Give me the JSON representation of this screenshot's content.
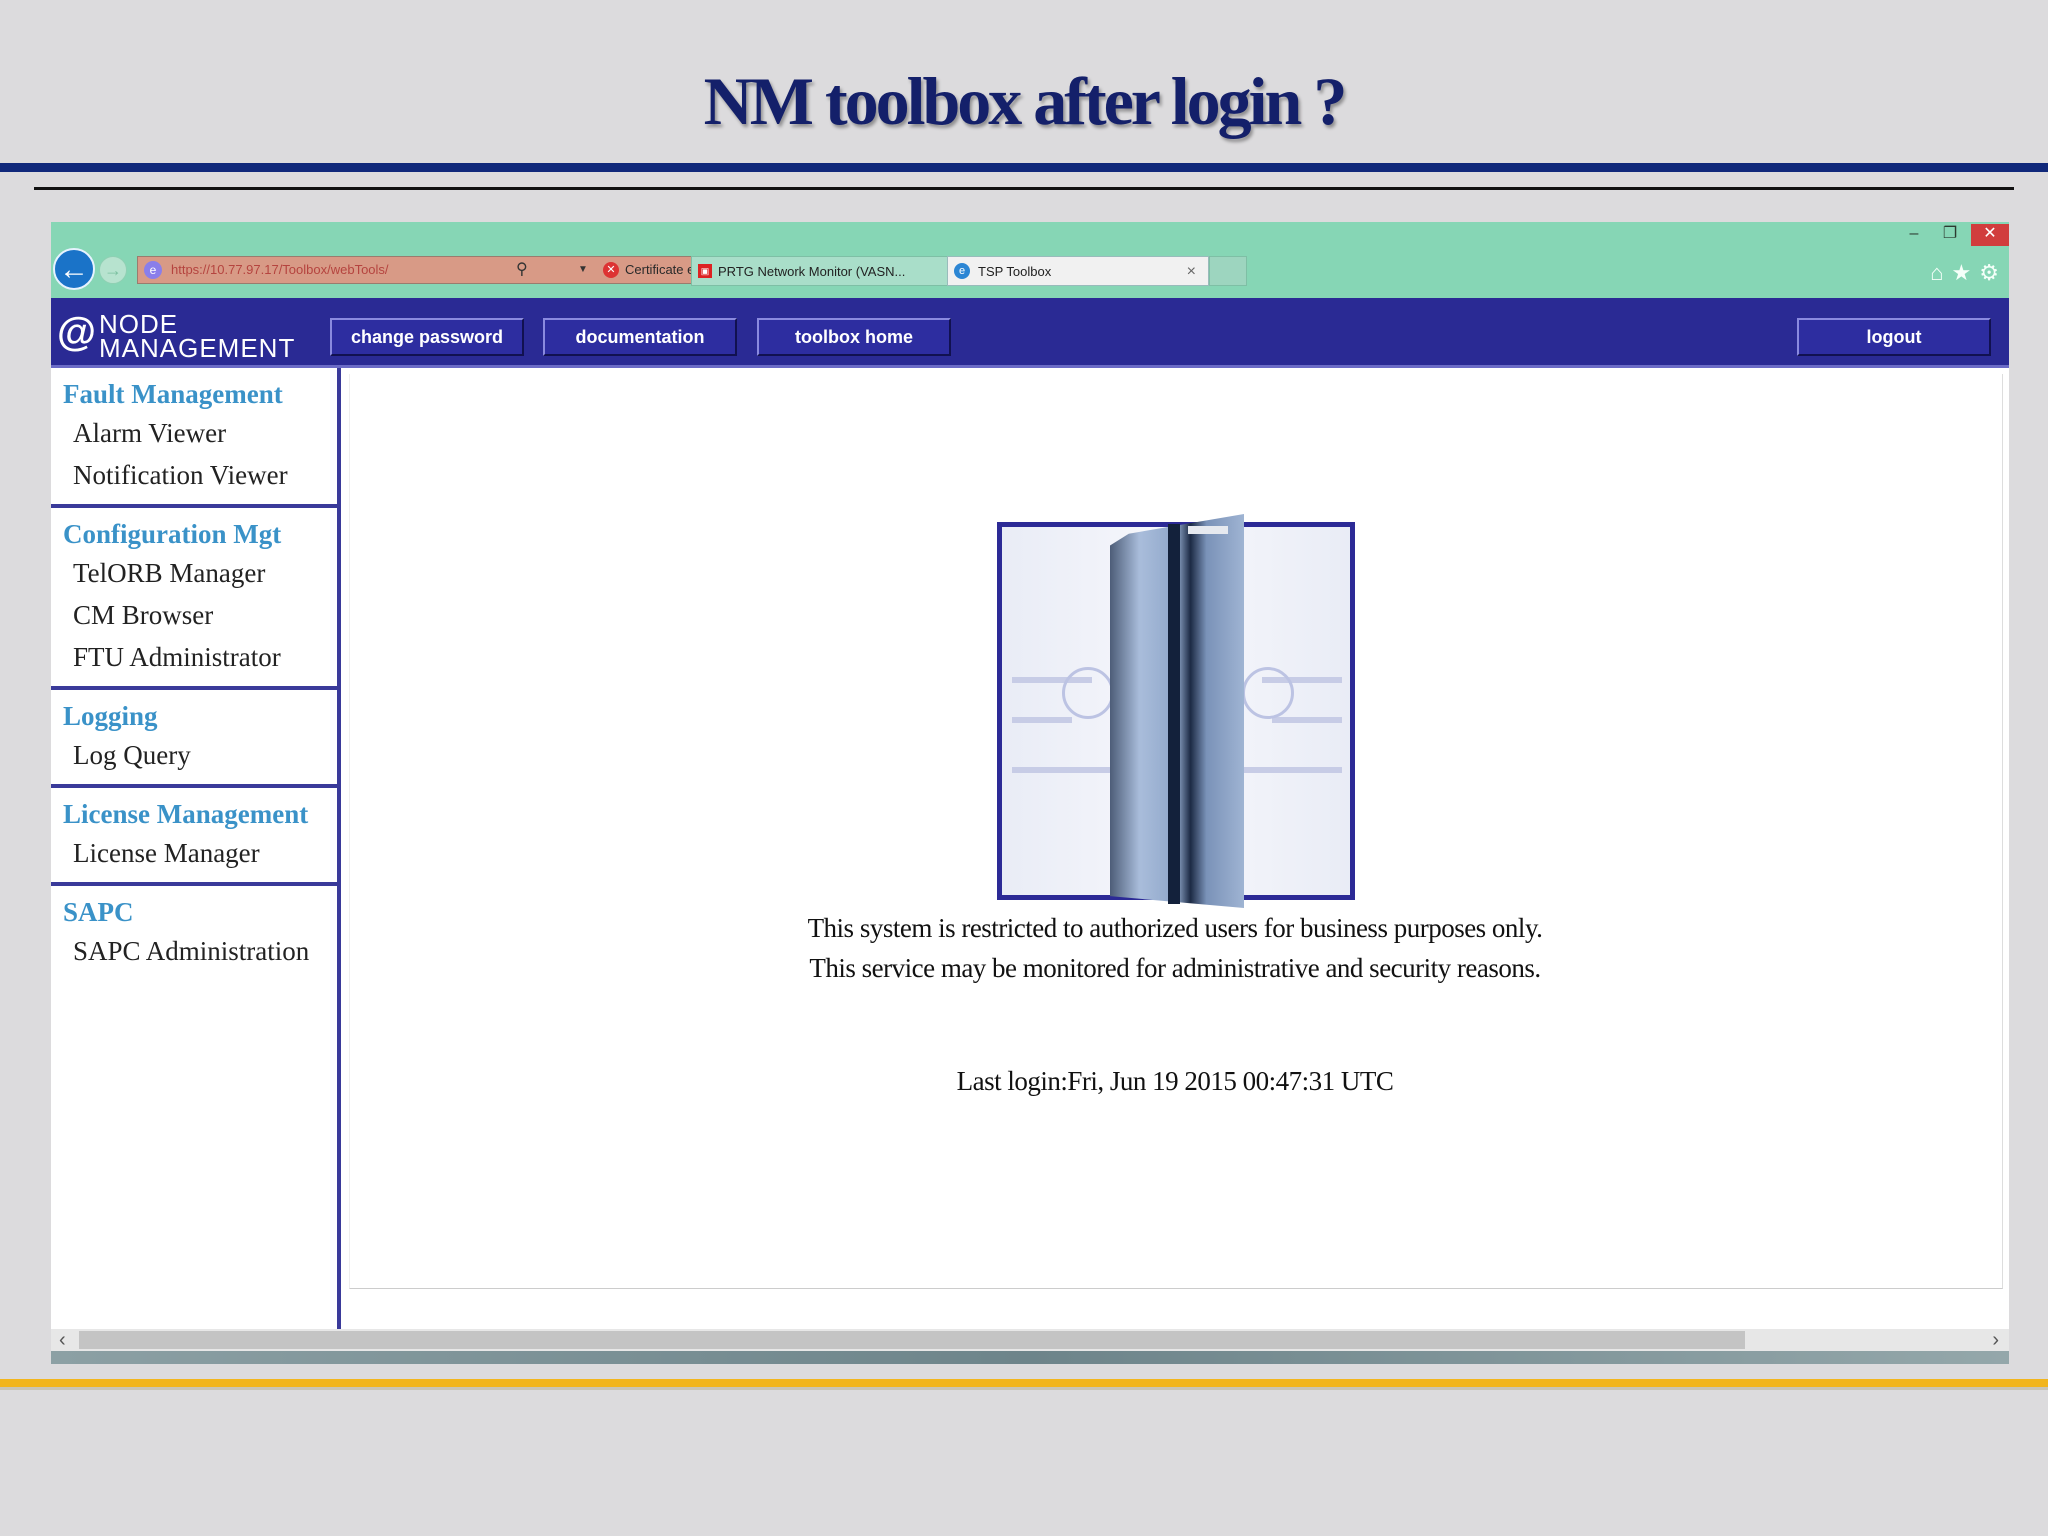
{
  "slide": {
    "title": "NM toolbox after login ?"
  },
  "browser": {
    "address_url": "https://10.77.97.17/Toolbox/webTools/",
    "cert_error": "Certificate error",
    "tabs": [
      {
        "label": "PRTG Network Monitor (VASN..."
      },
      {
        "label": "TSP Toolbox"
      }
    ]
  },
  "app": {
    "logo_at": "@",
    "logo_line1": "NODE",
    "logo_line2": "MANAGEMENT",
    "buttons": {
      "change_password": "change password",
      "documentation": "documentation",
      "toolbox_home": "toolbox home",
      "logout": "logout"
    }
  },
  "sidebar": {
    "sections": [
      {
        "title": "Fault Management",
        "items": [
          "Alarm Viewer",
          "Notification Viewer"
        ]
      },
      {
        "title": "Configuration Mgt",
        "items": [
          "TelORB Manager",
          "CM Browser",
          "FTU Administrator"
        ]
      },
      {
        "title": "Logging",
        "items": [
          "Log Query"
        ]
      },
      {
        "title": "License Management",
        "items": [
          "License Manager"
        ]
      },
      {
        "title": "SAPC",
        "items": [
          "SAPC Administration"
        ]
      }
    ]
  },
  "content": {
    "notice": "This system is restricted to authorized users for business purposes only. This service may be monitored for administrative and security reasons.",
    "last_login": "Last login:Fri, Jun 19 2015 00:47:31 UTC"
  },
  "colors": {
    "app_bar": "#2a2a94",
    "chrome": "#86d6b5",
    "section_title": "#3a92c8",
    "accent_rule": "#10287a",
    "bottom_rule": "#f2b51c"
  }
}
